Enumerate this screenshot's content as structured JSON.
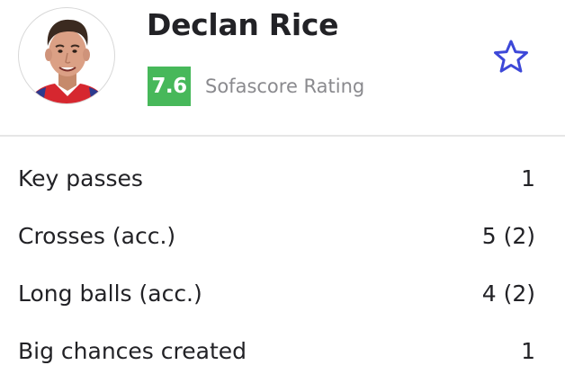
{
  "player": {
    "name": "Declan Rice",
    "rating": "7.6",
    "rating_label": "Sofascore Rating",
    "avatar_icon": "player-photo",
    "favorite_icon": "star-outline-icon"
  },
  "stats": [
    {
      "label": "Key passes",
      "value": "1"
    },
    {
      "label": "Crosses (acc.)",
      "value": "5 (2)"
    },
    {
      "label": "Long balls (acc.)",
      "value": "4 (2)"
    },
    {
      "label": "Big chances created",
      "value": "1"
    }
  ],
  "colors": {
    "rating_badge": "#47b85a",
    "star": "#3d48d8",
    "text": "#222226",
    "muted": "#8a8a8e",
    "divider": "#e6e6e6"
  }
}
